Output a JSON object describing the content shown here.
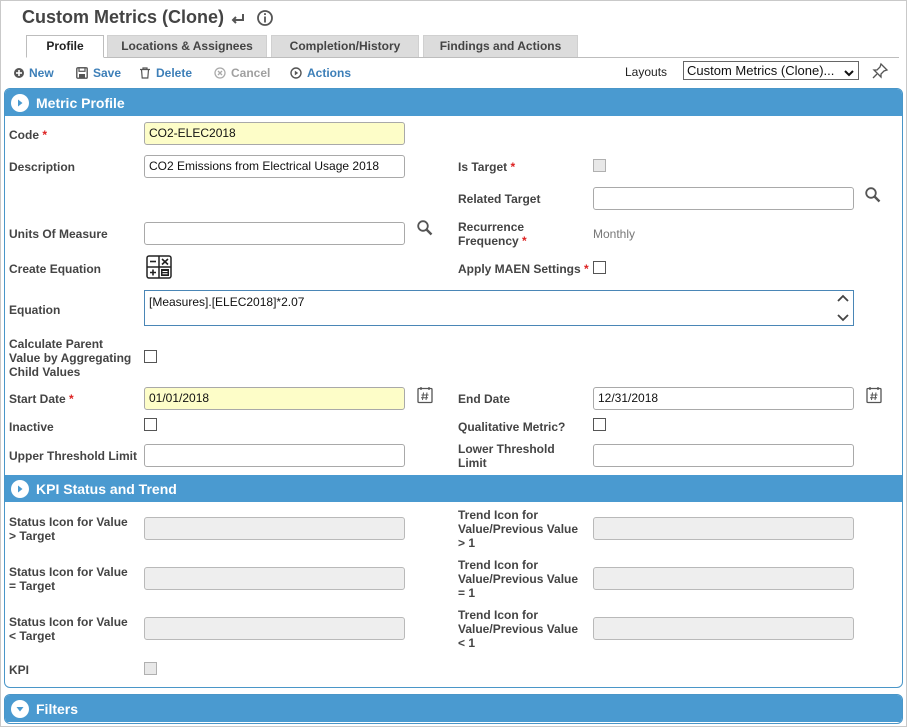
{
  "header": {
    "title": "Custom Metrics (Clone)"
  },
  "tabs": [
    {
      "label": "Profile",
      "active": true
    },
    {
      "label": "Locations & Assignees",
      "active": false
    },
    {
      "label": "Completion/History",
      "active": false
    },
    {
      "label": "Findings and Actions",
      "active": false
    }
  ],
  "toolbar": {
    "new_label": "New",
    "save_label": "Save",
    "delete_label": "Delete",
    "cancel_label": "Cancel",
    "actions_label": "Actions",
    "layouts_label": "Layouts",
    "layouts_value": "Custom Metrics (Clone)..."
  },
  "metric_profile": {
    "heading": "Metric Profile",
    "code_label": "Code",
    "code_value": "CO2-ELEC2018",
    "description_label": "Description",
    "description_value": "CO2 Emissions from Electrical Usage 2018",
    "is_target_label": "Is Target",
    "related_target_label": "Related Target",
    "related_target_value": "",
    "units_label": "Units Of Measure",
    "units_value": "",
    "recurrence_label_1": "Recurrence",
    "recurrence_label_2": "Frequency",
    "recurrence_value": "Monthly",
    "create_equation_label": "Create Equation",
    "apply_maen_label": "Apply MAEN Settings",
    "equation_label": "Equation",
    "equation_value": "[Measures].[ELEC2018]*2.07",
    "calc_parent_label_1": "Calculate Parent",
    "calc_parent_label_2": "Value by Aggregating",
    "calc_parent_label_3": "Child Values",
    "start_date_label": "Start Date",
    "start_date_value": "01/01/2018",
    "end_date_label": "End Date",
    "end_date_value": "12/31/2018",
    "inactive_label": "Inactive",
    "qualitative_label": "Qualitative Metric?",
    "upper_threshold_label": "Upper Threshold Limit",
    "upper_threshold_value": "",
    "lower_threshold_label_1": "Lower Threshold",
    "lower_threshold_label_2": "Limit",
    "lower_threshold_value": ""
  },
  "kpi": {
    "heading": "KPI Status and Trend",
    "status_gt_1": "Status Icon for Value",
    "status_gt_2": "> Target",
    "status_eq_1": "Status Icon for Value",
    "status_eq_2": "= Target",
    "status_lt_1": "Status Icon for Value",
    "status_lt_2": "< Target",
    "trend_gt_1": "Trend Icon for",
    "trend_gt_2": "Value/Previous Value",
    "trend_gt_3": "> 1",
    "trend_eq_1": "Trend Icon for",
    "trend_eq_2": "Value/Previous Value",
    "trend_eq_3": "= 1",
    "trend_lt_1": "Trend Icon for",
    "trend_lt_2": "Value/Previous Value",
    "trend_lt_3": "< 1",
    "kpi_label": "KPI"
  },
  "filters": {
    "heading": "Filters"
  },
  "colors": {
    "accent": "#4a9ad0",
    "link": "#3d7fb8",
    "required": "#d22222",
    "required_field_bg": "#fdfdc8"
  }
}
